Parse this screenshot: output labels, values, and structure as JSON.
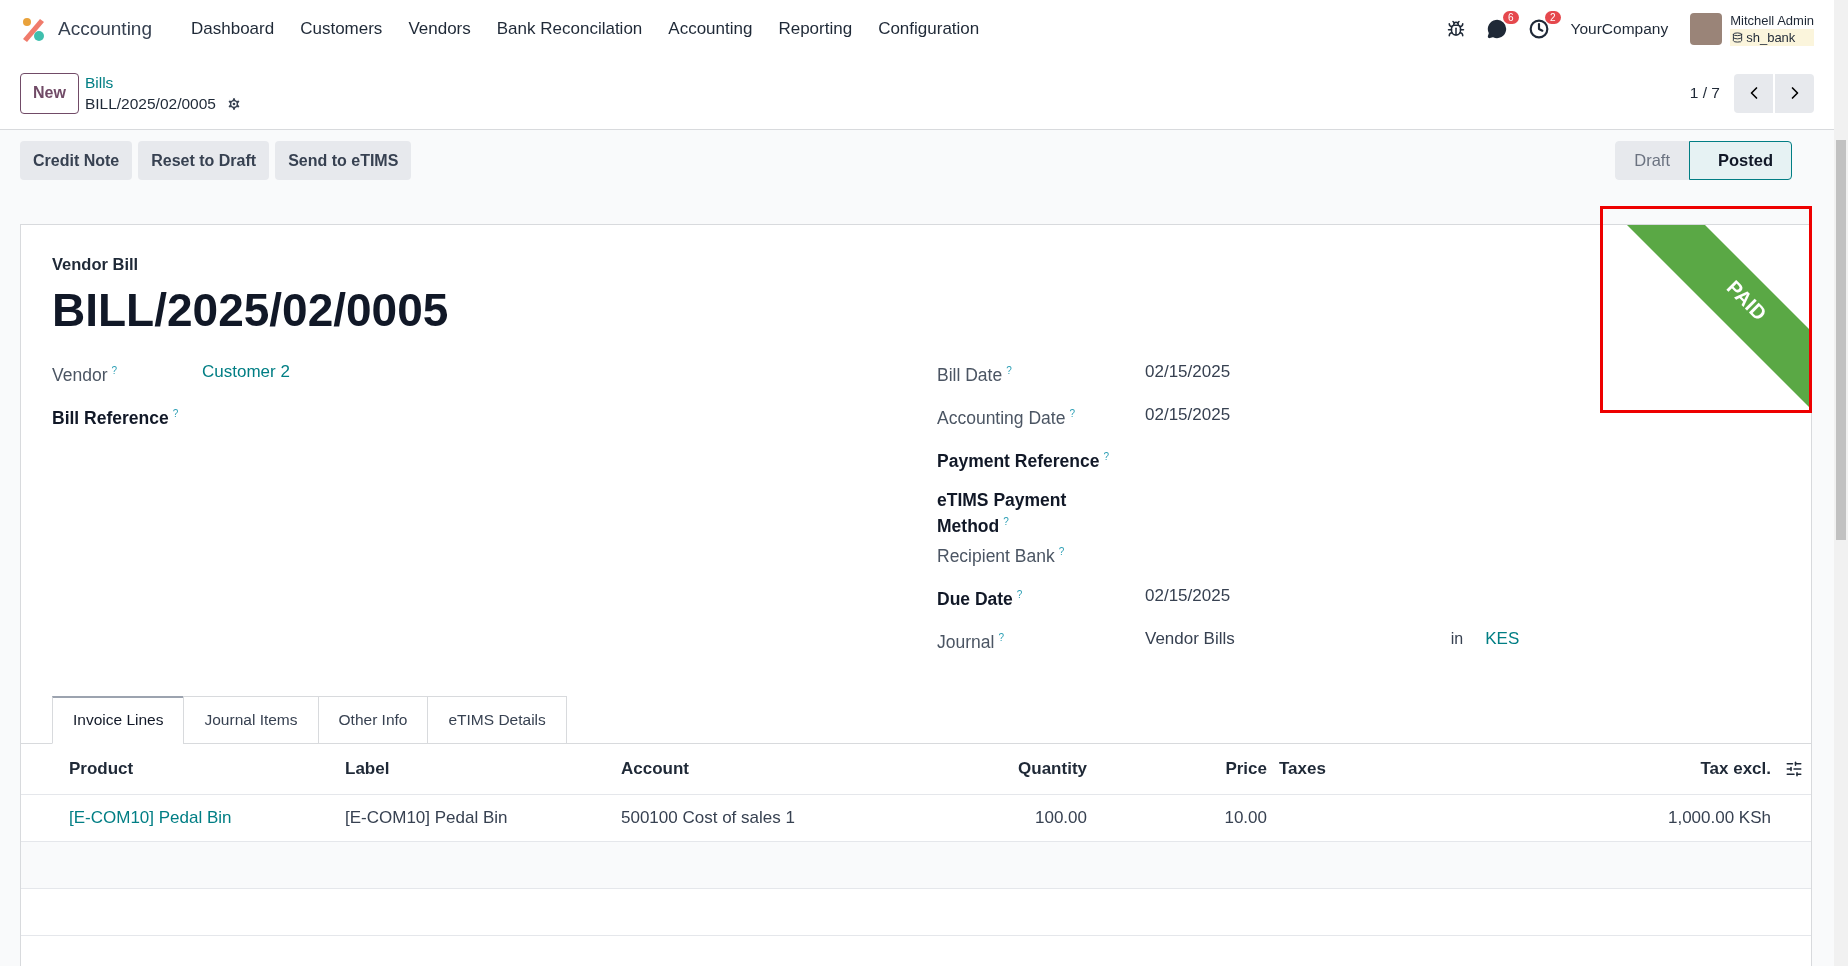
{
  "app": {
    "name": "Accounting"
  },
  "menu": [
    {
      "label": "Dashboard"
    },
    {
      "label": "Customers"
    },
    {
      "label": "Vendors"
    },
    {
      "label": "Bank Reconcilation"
    },
    {
      "label": "Accounting"
    },
    {
      "label": "Reporting"
    },
    {
      "label": "Configuration"
    }
  ],
  "systray": {
    "messages_count": "6",
    "activities_count": "2",
    "company": "YourCompany",
    "user": "Mitchell Admin",
    "database": "sh_bank"
  },
  "breadcrumb": {
    "new_button": "New",
    "parent": "Bills",
    "current": "BILL/2025/02/0005"
  },
  "pager": "1 / 7",
  "actions": [
    {
      "label": "Credit Note"
    },
    {
      "label": "Reset to Draft"
    },
    {
      "label": "Send to eTIMS"
    }
  ],
  "status_steps": [
    {
      "label": "Draft",
      "selected": false
    },
    {
      "label": "Posted",
      "selected": true
    }
  ],
  "ribbon": {
    "text": "PAID"
  },
  "form": {
    "type_label": "Vendor Bill",
    "title": "BILL/2025/02/0005",
    "left_fields": [
      {
        "label": "Vendor",
        "help_mark": "?",
        "required": false,
        "value": "Customer 2",
        "link": true
      },
      {
        "label": "Bill Reference",
        "help_mark": "?",
        "required": true
      }
    ],
    "right_fields": [
      {
        "label": "Bill Date",
        "help_mark": "?",
        "required": false,
        "value": "02/15/2025"
      },
      {
        "label": "Accounting Date",
        "help_mark": "?",
        "required": false,
        "value": "02/15/2025"
      },
      {
        "label": "Payment Reference",
        "help_mark": "?",
        "required": true
      },
      {
        "label": "eTIMS Payment Method",
        "help_mark": "?",
        "required": true
      },
      {
        "label": "Recipient Bank",
        "help_mark": "?",
        "required": false
      },
      {
        "label": "Due Date",
        "help_mark": "?",
        "required": true,
        "value": "02/15/2025"
      },
      {
        "label": "Journal",
        "help_mark": "?",
        "required": false,
        "value": "Vendor Bills",
        "currency_prefix": "in",
        "currency": "KES"
      }
    ]
  },
  "tabs": [
    {
      "label": "Invoice Lines",
      "selected": true
    },
    {
      "label": "Journal Items",
      "selected": false
    },
    {
      "label": "Other Info",
      "selected": false
    },
    {
      "label": "eTIMS Details",
      "selected": false
    }
  ],
  "table": {
    "columns": [
      {
        "label": "Product",
        "kind": "text"
      },
      {
        "label": "Label",
        "kind": "text"
      },
      {
        "label": "Account",
        "kind": "text"
      },
      {
        "label": "Quantity",
        "kind": "number"
      },
      {
        "label": "Price",
        "kind": "number"
      },
      {
        "label": "Taxes",
        "kind": "text"
      },
      {
        "label": "Tax excl.",
        "kind": "number"
      }
    ],
    "rows": [
      {
        "cells": [
          {
            "text": "[E-COM10] Pedal Bin",
            "link": true
          },
          {
            "text": "[E-COM10] Pedal Bin",
            "link": false
          },
          {
            "text": "500100 Cost of sales 1",
            "link": false
          },
          {
            "text": "100.00",
            "link": false
          },
          {
            "text": "10.00",
            "link": false
          },
          null,
          {
            "text": "1,000.00 KSh",
            "link": false
          }
        ]
      }
    ]
  }
}
